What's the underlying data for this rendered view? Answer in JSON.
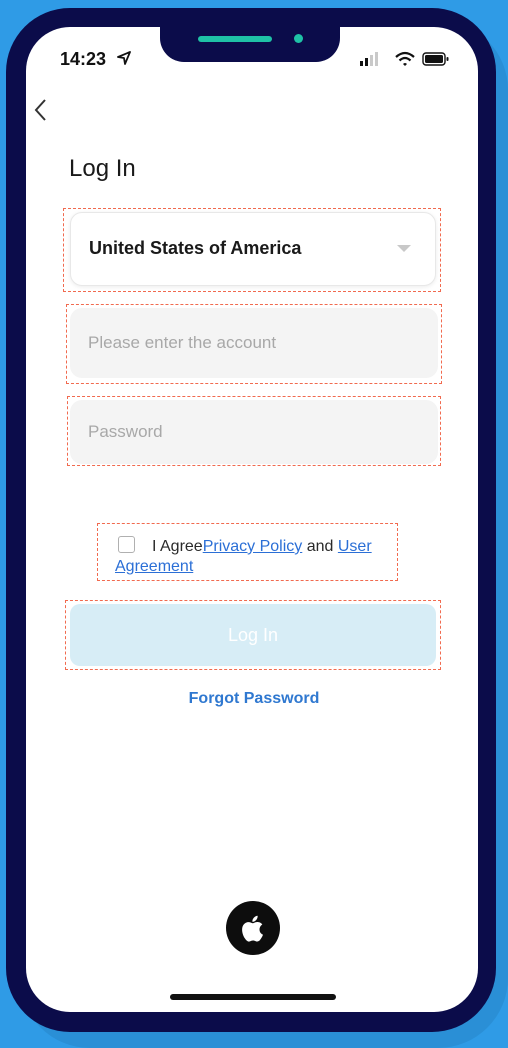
{
  "status_bar": {
    "time": "14:23",
    "icons": [
      "location-arrow-icon",
      "signal-icon",
      "wifi-icon",
      "battery-icon"
    ]
  },
  "header": {
    "back_icon": "chevron-left-icon",
    "title": "Log In"
  },
  "form": {
    "country": {
      "selected": "United States of America",
      "icon": "caret-down-icon"
    },
    "account": {
      "placeholder": "Please enter the account",
      "value": ""
    },
    "password": {
      "placeholder": "Password",
      "value": ""
    },
    "agreement": {
      "checked": false,
      "prefix": "I Agree",
      "privacy_link": "Privacy Policy",
      "conjunction": " and ",
      "user_link_part1": "User",
      "user_link_part2": "Agreement"
    },
    "login_button": "Log In",
    "forgot_password": "Forgot Password"
  },
  "social": {
    "apple_icon": "apple-logo-icon"
  },
  "colors": {
    "background": "#2f9be6",
    "phone_frame": "#0b0c4a",
    "accent_teal": "#1fc2a6",
    "link_blue": "#2f78d0",
    "button_disabled": "#d7edf6",
    "annotation_dash": "#f16a4f"
  }
}
